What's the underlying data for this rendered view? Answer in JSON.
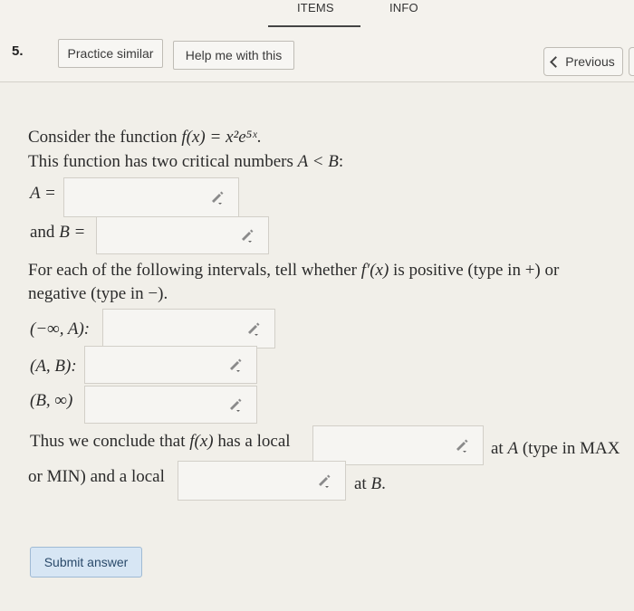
{
  "tabs": {
    "items": "ITEMS",
    "info": "INFO"
  },
  "question_number": "5.",
  "buttons": {
    "practice_similar": "Practice similar",
    "help": "Help me with this",
    "previous": "Previous"
  },
  "problem": {
    "line1_prefix": "Consider the function ",
    "function": "f(x) = x²e⁵ˣ",
    "line1_suffix": ".",
    "line2_prefix": "This function has two critical numbers ",
    "line2_math": "A < B",
    "line2_suffix": ":",
    "a_label": "A =",
    "b_label_prefix": "and ",
    "b_label_math": "B =",
    "interval_intro_1_prefix": "For each of the following intervals, tell whether ",
    "interval_intro_1_math": "f′(x)",
    "interval_intro_1_suffix": " is positive (type in +) or",
    "interval_intro_2": "negative (type in −).",
    "interval_1": "(−∞, A):",
    "interval_2": "(A, B):",
    "interval_3": "(B, ∞)",
    "conclude_prefix": "Thus we conclude that ",
    "conclude_math": "f(x)",
    "conclude_suffix": " has a local",
    "at_a_prefix": "at ",
    "at_a_math": "A",
    "at_a_suffix": " (type in MAX",
    "line_min": "or MIN) and a local",
    "at_b_prefix": "at ",
    "at_b_math": "B",
    "at_b_suffix": "."
  },
  "inputs": {
    "a_value": "",
    "b_value": "",
    "interval_1": "",
    "interval_2": "",
    "interval_3": "",
    "extremum_a": "",
    "extremum_b": ""
  },
  "submit_label": "Submit answer"
}
